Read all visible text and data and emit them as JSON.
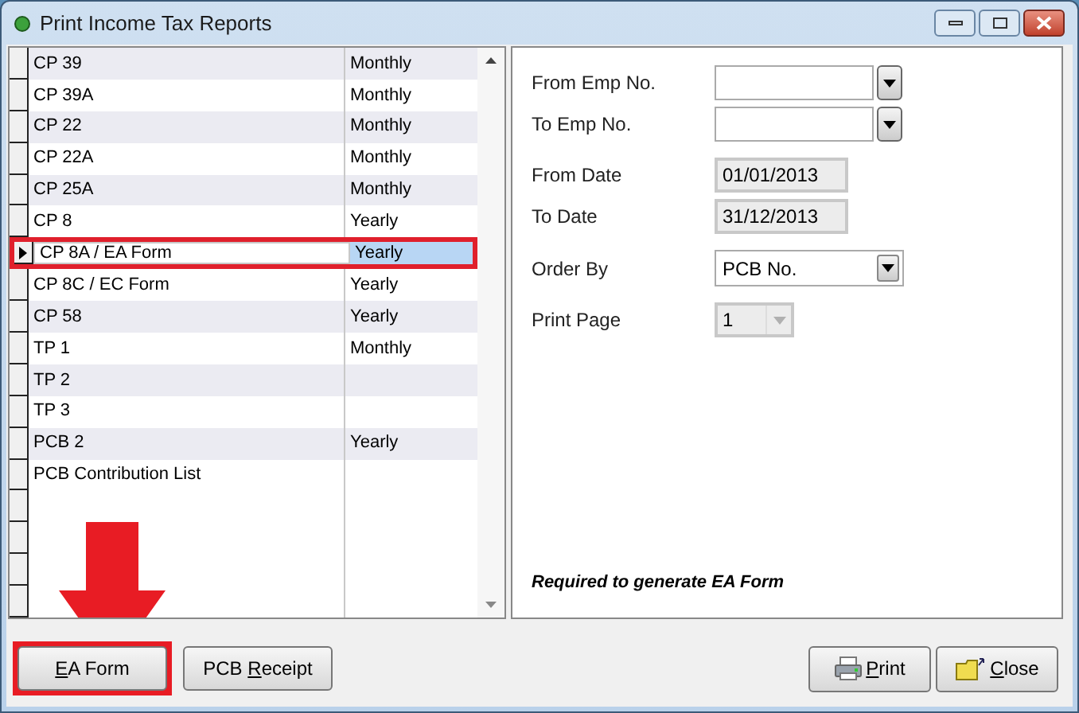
{
  "window": {
    "title": "Print Income Tax Reports"
  },
  "reports": [
    {
      "name": "CP 39",
      "period": "Monthly",
      "selected": false,
      "annotated": false
    },
    {
      "name": "CP 39A",
      "period": "Monthly",
      "selected": false,
      "annotated": false
    },
    {
      "name": "CP 22",
      "period": "Monthly",
      "selected": false,
      "annotated": false
    },
    {
      "name": "CP 22A",
      "period": "Monthly",
      "selected": false,
      "annotated": false
    },
    {
      "name": "CP 25A",
      "period": "Monthly",
      "selected": false,
      "annotated": false
    },
    {
      "name": "CP 8",
      "period": "Yearly",
      "selected": false,
      "annotated": false
    },
    {
      "name": "CP 8A / EA Form",
      "period": "Yearly",
      "selected": true,
      "annotated": true
    },
    {
      "name": "CP 8C / EC Form",
      "period": "Yearly",
      "selected": false,
      "annotated": false
    },
    {
      "name": "CP 58",
      "period": "Yearly",
      "selected": false,
      "annotated": false
    },
    {
      "name": "TP 1",
      "period": "Monthly",
      "selected": false,
      "annotated": false
    },
    {
      "name": "TP 2",
      "selected": false,
      "annotated": false
    },
    {
      "name": "TP 3",
      "selected": false,
      "annotated": false
    },
    {
      "name": "PCB 2",
      "period": "Yearly",
      "selected": false,
      "annotated": false
    },
    {
      "name": "PCB Contribution List",
      "selected": false,
      "annotated": false
    }
  ],
  "form": [
    {
      "kind": "combo",
      "label": "From Emp No."
    },
    {
      "kind": "combo",
      "label": "To Emp No."
    },
    {
      "kind": "date",
      "label": "From Date",
      "value": "01/01/2013"
    },
    {
      "kind": "date",
      "label": "To Date",
      "value": "31/12/2013"
    },
    {
      "kind": "select",
      "label": "Order By",
      "value": "PCB No."
    },
    {
      "kind": "spin",
      "label": "Print Page",
      "value": "1",
      "disabled": true
    }
  ],
  "note": "Required to generate EA Form",
  "left_buttons": [
    {
      "label": {
        "key": "E",
        "after": "A Form"
      },
      "annotated": true
    },
    {
      "label": {
        "before": "PCB ",
        "key": "R",
        "after": "eceipt"
      },
      "annotated": false
    }
  ],
  "right_buttons": [
    {
      "kind": "print",
      "label": {
        "key": "P",
        "after": "rint"
      }
    },
    {
      "kind": "close",
      "label": {
        "key": "C",
        "after": "lose"
      }
    }
  ]
}
